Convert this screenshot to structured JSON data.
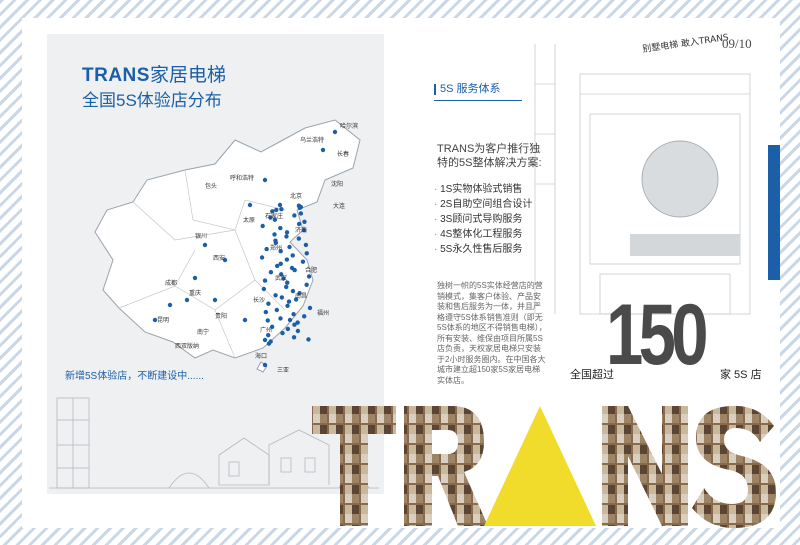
{
  "map_page": {
    "title_brand": "TRANS",
    "title_rest": "家居电梯",
    "subtitle": "全国5S体验店分布",
    "footnote": "新增5S体验店，不断建设中......",
    "city_labels": [
      "哈尔滨",
      "乌兰浩特",
      "长春",
      "呼和浩特",
      "沈阳",
      "包头",
      "北京",
      "大连",
      "石家庄",
      "济南",
      "太原",
      "银川",
      "西安",
      "郑州",
      "合肥",
      "武汉",
      "成都",
      "重庆",
      "长沙",
      "南昌",
      "贵阳",
      "昆明",
      "福州",
      "南宁",
      "广州",
      "海口",
      "西双版纳",
      "三亚"
    ]
  },
  "right_page": {
    "page_number": "09/10",
    "handwriting": "别墅电梯 敢入TRANS",
    "section_title": "5S 服务体系",
    "intro": "TRANS为客户推行独特的5S整体解决方案:",
    "services": [
      "1S实物体验式销售",
      "2S自助空间组合设计",
      "3S顾问式导购服务",
      "4S整体化工程服务",
      "5S永久性售后服务"
    ],
    "body_text": "独树一帜的5S实体经营店的营销模式，集客户体验、产品安装和售后服务为一体，并且严格遵守5S体系销售准则（即无5S体系的地区不得销售电梯），所有安装、维保由项目所属5S店负责，天权家居电梯只安装于2小时服务圈内。在中国各大城市建立超150家5S家居电梯实体店。",
    "big_number": "150",
    "prefix": "全国超过",
    "suffix": "家 5S 店",
    "brand_word": "TRANS"
  },
  "colors": {
    "brand_blue": "#1a5fa8",
    "yellow": "#f2dc2b",
    "gray_text": "#4a4a4a"
  }
}
